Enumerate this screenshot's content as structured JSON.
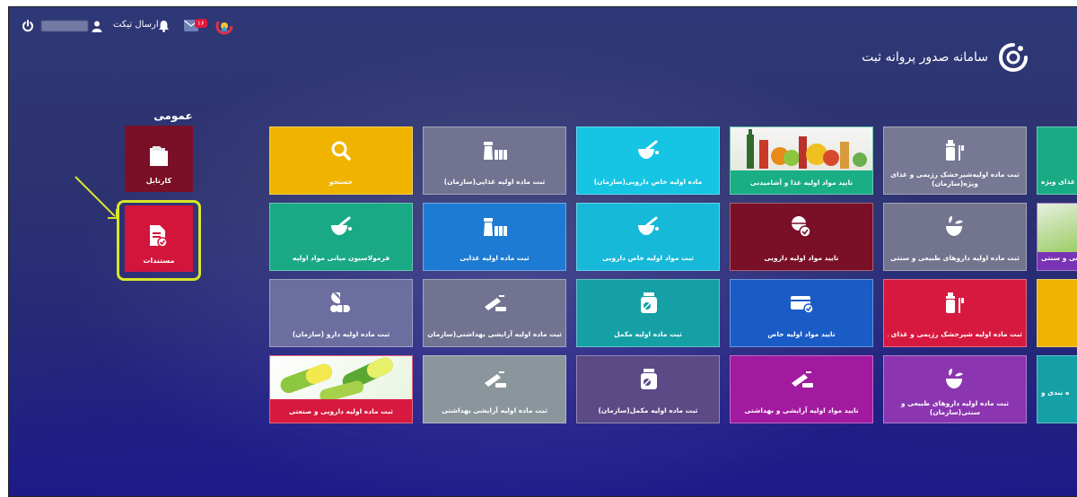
{
  "header": {
    "username": "",
    "send_ticket": "ارسال تیکت",
    "notification_count": "۱۶",
    "app_title": "سامانه صدور پروانه ثبت"
  },
  "sidebar": {
    "section_title": "عمومی",
    "items": [
      {
        "label": "کارتابل",
        "icon": "folder-icon"
      },
      {
        "label": "مستندات",
        "icon": "document-check-icon"
      }
    ]
  },
  "tiles": [
    {
      "label": "جستجو",
      "icon": "search-icon",
      "color": "#f0b400"
    },
    {
      "label": "ثبت ماده اولیه غذایی(سازمان)",
      "icon": "food-jars-icon",
      "color": "#727391"
    },
    {
      "label": "ماده اولیه خاص دارویی(سازمان)",
      "icon": "mortar-icon",
      "color": "#16c4e4"
    },
    {
      "label": "تایید مواد اولیه غذا و آشامیدنی",
      "icon": "food-jars-icon",
      "color": "#1aae85"
    },
    {
      "label": "ثبت ماده اولیه‌شیرخشک رژیمی و غذای ویژه(سازمان)",
      "icon": "baby-bottle-icon",
      "color": "#767894"
    },
    {
      "label": "و غذای ویژه",
      "icon": "",
      "color": "#19ab84"
    },
    {
      "label": "فرمولاسیون میانی مواد اولیه",
      "icon": "mortar-icon",
      "color": "#1aa985"
    },
    {
      "label": "ثبت ماده اولیه غذایی",
      "icon": "food-jars-icon",
      "color": "#1d7bd3"
    },
    {
      "label": "ثبت مواد اولیه خاص دارویی",
      "icon": "mortar-icon",
      "color": "#17b9d8"
    },
    {
      "label": "تایید مواد اولیه دارویی",
      "icon": "pills-check-icon",
      "color": "#7a0f28"
    },
    {
      "label": "ثبت ماده اولیه داروهای طبیعی و سنتی",
      "icon": "herbal-mortar-icon",
      "color": "#73758f"
    },
    {
      "label": "طبیعی و سنتی",
      "icon": "",
      "color": "#7a33b4"
    },
    {
      "label": "ثبت ماده اولیه دارو (سازمان)",
      "icon": "pills-icon",
      "color": "#6c6ea0"
    },
    {
      "label": "ثبت ماده اولیه آرایشی بهداشتی(سازمان)",
      "icon": "cosmetic-icon",
      "color": "#717391"
    },
    {
      "label": "ثبت ماده اولیه مکمل",
      "icon": "supplement-jar-icon",
      "color": "#15a0a6"
    },
    {
      "label": "تایید مواد اولیه خاص",
      "icon": "card-check-icon",
      "color": "#1a5cc6"
    },
    {
      "label": "ثبت ماده اولیه شیرخشک رژیمی و غذای ویژه",
      "icon": "baby-bottle-icon",
      "color": "#d8193f"
    },
    {
      "label": "",
      "icon": "",
      "color": "#f0b400"
    },
    {
      "label": "ثبت ماده اولیه دارویی و صنعتی",
      "icon": "pills-icon",
      "color": "#d8193f"
    },
    {
      "label": "ثبت ماده اولیه آرایشی بهداشتی",
      "icon": "cosmetic-icon",
      "color": "#8b969c"
    },
    {
      "label": "ثبت ماده اولیه مکمل(سازمان)",
      "icon": "supplement-jar-icon",
      "color": "#5b4a86"
    },
    {
      "label": "تایید مواد اولیه آرایشی و بهداشتی",
      "icon": "cosmetic-icon",
      "color": "#a21aa0"
    },
    {
      "label": "ثبت ماده اولیه داروهای طبیعی و سنتی(سازمان)",
      "icon": "herbal-mortar-icon",
      "color": "#8b36b0"
    },
    {
      "label": "ه بندی و",
      "icon": "",
      "color": "#15a0a6"
    }
  ]
}
